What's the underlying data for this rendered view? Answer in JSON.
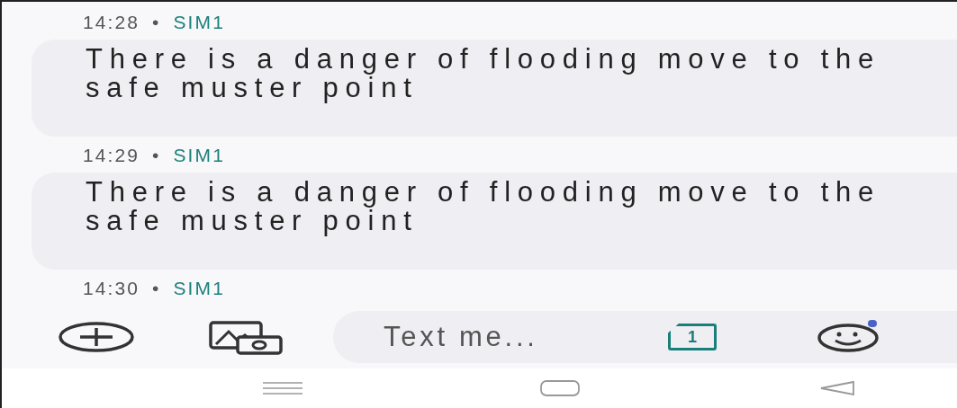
{
  "messages": [
    {
      "time": "14:28",
      "separator": "•",
      "sim": "SIM1",
      "text": "There is a danger of flooding move to the safe muster point"
    },
    {
      "time": "14:29",
      "separator": "•",
      "sim": "SIM1",
      "text": "There is a danger of flooding move to the safe muster point"
    },
    {
      "time": "14:30",
      "separator": "•",
      "sim": "SIM1"
    }
  ],
  "composer": {
    "placeholder": "Text me...",
    "sim_badge": "1",
    "emoji_notification": true
  }
}
